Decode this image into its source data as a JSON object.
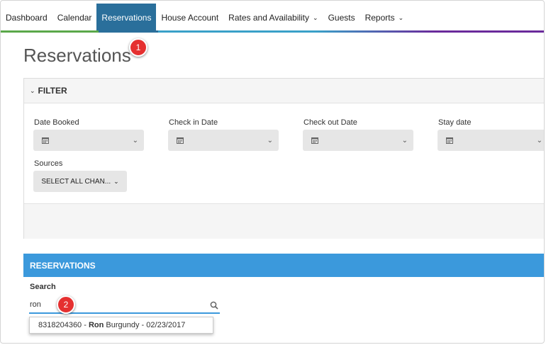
{
  "nav": {
    "items": [
      {
        "label": "Dashboard",
        "active": false,
        "has_dropdown": false
      },
      {
        "label": "Calendar",
        "active": false,
        "has_dropdown": false
      },
      {
        "label": "Reservations",
        "active": true,
        "has_dropdown": false
      },
      {
        "label": "House Account",
        "active": false,
        "has_dropdown": false
      },
      {
        "label": "Rates and Availability",
        "active": false,
        "has_dropdown": true
      },
      {
        "label": "Guests",
        "active": false,
        "has_dropdown": false
      },
      {
        "label": "Reports",
        "active": false,
        "has_dropdown": true
      }
    ]
  },
  "page": {
    "title": "Reservations"
  },
  "callouts": {
    "one": "1",
    "two": "2"
  },
  "filter": {
    "title": "FILTER",
    "date_fields": [
      {
        "label": "Date Booked"
      },
      {
        "label": "Check in Date"
      },
      {
        "label": "Check out Date"
      },
      {
        "label": "Stay date"
      }
    ],
    "sources_label": "Sources",
    "sources_button": "SELECT ALL CHAN..."
  },
  "reservations": {
    "title": "RESERVATIONS",
    "search_label": "Search",
    "search_value": "ron",
    "suggestion": {
      "id": "8318204360",
      "separator": " - ",
      "highlight": "Ron",
      "rest": " Burgundy - 02/23/2017"
    }
  },
  "colors": {
    "accent": "#3b99dc",
    "nav_active": "#2a6f9b",
    "callout": "#e53030"
  },
  "icons": {
    "calendar": "calendar-icon",
    "chevron": "chevron-down-icon",
    "search": "search-icon"
  }
}
